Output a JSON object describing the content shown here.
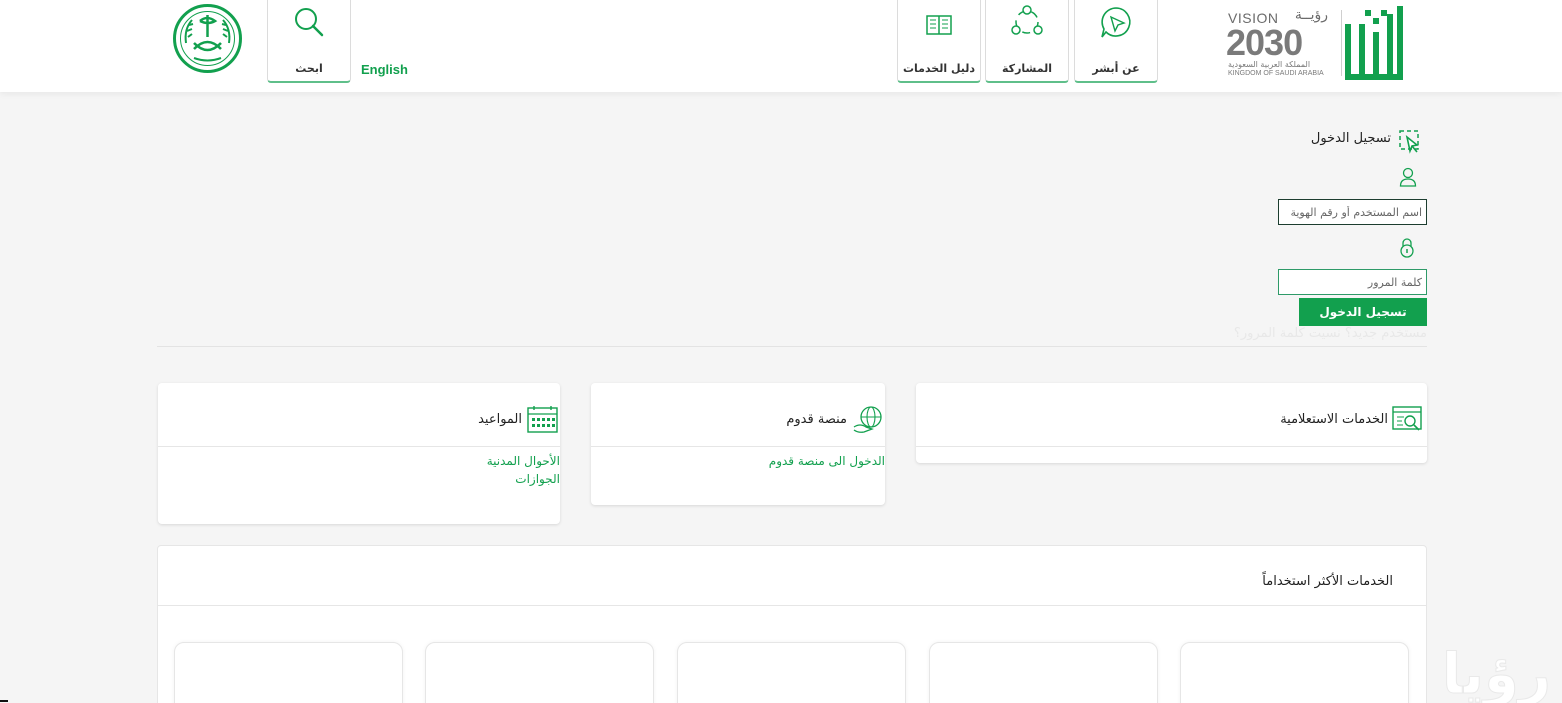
{
  "header": {
    "nav": {
      "about": "عن أبشر",
      "participation": "المشاركة",
      "services_guide": "دليل الخدمات",
      "search": "ابحث"
    },
    "language_link": "English",
    "vision_logo": {
      "title_en": "VISION",
      "title_ar": "رؤيــة",
      "number": "2030",
      "subtitle_ar": "المملكة العربية السعودية",
      "subtitle_en": "KINGDOM OF SAUDI ARABIA"
    },
    "absher_logo": "أبشر"
  },
  "login": {
    "title": "تسجيل الدخول",
    "username_placeholder": "اسم المستخدم أو رقم الهوية",
    "password_placeholder": "كلمة المرور",
    "submit_label": "تسجيل الدخول",
    "forgot_link": "مستخدم جديد؟ نسيت كلمة المرور؟"
  },
  "cards": {
    "inquiry": {
      "title": "الخدمات الاستعلامية"
    },
    "qudoom": {
      "title": "منصة قدوم",
      "link": "الدخول الى منصة قدوم"
    },
    "appointments": {
      "title": "المواعيد",
      "links": [
        "الأحوال المدنية",
        "الجوازات"
      ]
    }
  },
  "most_used": {
    "title": "الخدمات الأكثر استخداماً"
  },
  "watermark_text": "رؤيا",
  "colors": {
    "brand_green": "#12a04e",
    "field_border": "#2e9a68",
    "nav_underline": "#5fbf8a",
    "page_bg": "#f5f5f5"
  },
  "icons": {
    "about": "chat-bubble-icon",
    "participation": "share-icon",
    "services_guide": "book-icon",
    "search": "search-icon",
    "login": "cursor-select-icon",
    "user": "user-icon",
    "password": "lock-icon",
    "inquiry": "search-window-icon",
    "qudoom": "globe-hand-icon",
    "appointments": "calendar-icon"
  }
}
